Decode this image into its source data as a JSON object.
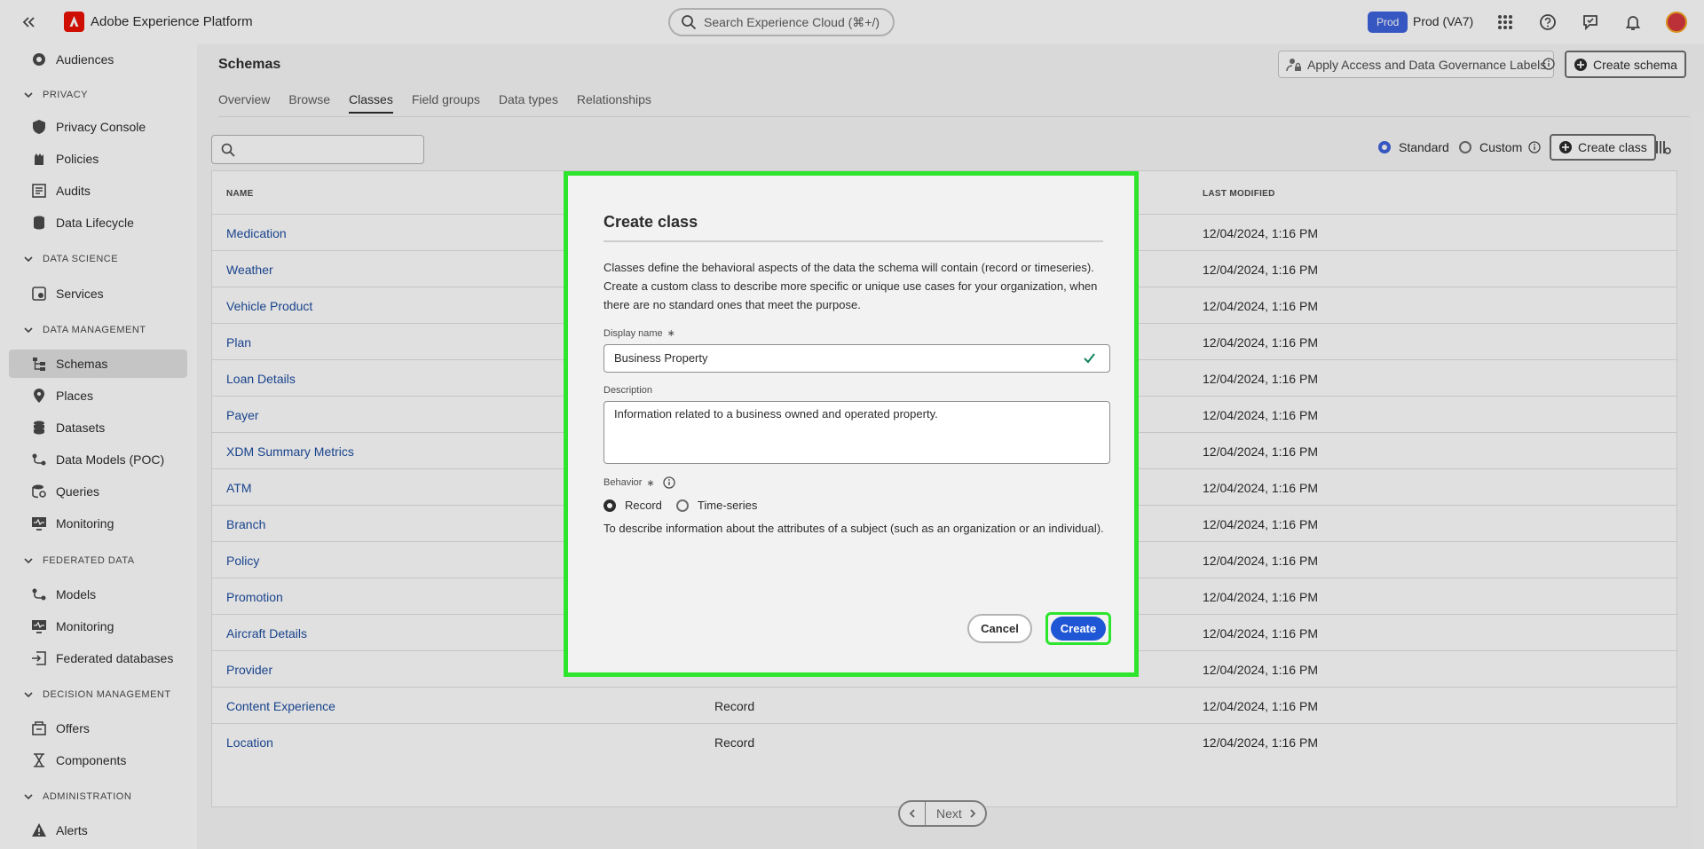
{
  "header": {
    "app_name": "Adobe Experience Platform",
    "search_placeholder": "Search Experience Cloud (⌘+/)",
    "env_badge": "Prod",
    "env_name": "Prod (VA7)"
  },
  "sidebar": {
    "items": [
      {
        "type": "item",
        "label": "Audiences",
        "icon": "audiences-icon"
      },
      {
        "type": "section",
        "label": "PRIVACY"
      },
      {
        "type": "item",
        "label": "Privacy Console",
        "icon": "privacy-console-icon"
      },
      {
        "type": "item",
        "label": "Policies",
        "icon": "policies-icon"
      },
      {
        "type": "item",
        "label": "Audits",
        "icon": "audits-icon"
      },
      {
        "type": "item",
        "label": "Data Lifecycle",
        "icon": "data-lifecycle-icon"
      },
      {
        "type": "section",
        "label": "DATA SCIENCE"
      },
      {
        "type": "item",
        "label": "Services",
        "icon": "services-icon"
      },
      {
        "type": "section",
        "label": "DATA MANAGEMENT"
      },
      {
        "type": "item",
        "label": "Schemas",
        "icon": "schemas-icon",
        "active": true
      },
      {
        "type": "item",
        "label": "Places",
        "icon": "places-icon"
      },
      {
        "type": "item",
        "label": "Datasets",
        "icon": "datasets-icon"
      },
      {
        "type": "item",
        "label": "Data Models (POC)",
        "icon": "data-models-icon"
      },
      {
        "type": "item",
        "label": "Queries",
        "icon": "queries-icon"
      },
      {
        "type": "item",
        "label": "Monitoring",
        "icon": "monitoring-icon"
      },
      {
        "type": "section",
        "label": "FEDERATED DATA"
      },
      {
        "type": "item",
        "label": "Models",
        "icon": "models-icon"
      },
      {
        "type": "item",
        "label": "Monitoring",
        "icon": "monitoring-icon"
      },
      {
        "type": "item",
        "label": "Federated databases",
        "icon": "federated-databases-icon"
      },
      {
        "type": "section",
        "label": "DECISION MANAGEMENT"
      },
      {
        "type": "item",
        "label": "Offers",
        "icon": "offers-icon"
      },
      {
        "type": "item",
        "label": "Components",
        "icon": "components-icon"
      },
      {
        "type": "section",
        "label": "ADMINISTRATION"
      },
      {
        "type": "item",
        "label": "Alerts",
        "icon": "alerts-icon"
      }
    ]
  },
  "page": {
    "title": "Schemas",
    "tabs": [
      "Overview",
      "Browse",
      "Classes",
      "Field groups",
      "Data types",
      "Relationships"
    ],
    "active_tab": "Classes",
    "apply_labels_button": "Apply Access and Data Governance Labels",
    "create_schema_button": "Create schema",
    "filter_standard": "Standard",
    "filter_custom": "Custom",
    "create_class_button": "Create class"
  },
  "table": {
    "headers": [
      "NAME",
      "",
      "LAST MODIFIED"
    ],
    "rows": [
      {
        "name": "Medication",
        "behavior": "",
        "modified": "12/04/2024, 1:16 PM"
      },
      {
        "name": "Weather",
        "behavior": "",
        "modified": "12/04/2024, 1:16 PM"
      },
      {
        "name": "Vehicle Product",
        "behavior": "",
        "modified": "12/04/2024, 1:16 PM"
      },
      {
        "name": "Plan",
        "behavior": "",
        "modified": "12/04/2024, 1:16 PM"
      },
      {
        "name": "Loan Details",
        "behavior": "",
        "modified": "12/04/2024, 1:16 PM"
      },
      {
        "name": "Payer",
        "behavior": "",
        "modified": "12/04/2024, 1:16 PM"
      },
      {
        "name": "XDM Summary Metrics",
        "behavior": "",
        "modified": "12/04/2024, 1:16 PM"
      },
      {
        "name": "ATM",
        "behavior": "",
        "modified": "12/04/2024, 1:16 PM"
      },
      {
        "name": "Branch",
        "behavior": "",
        "modified": "12/04/2024, 1:16 PM"
      },
      {
        "name": "Policy",
        "behavior": "",
        "modified": "12/04/2024, 1:16 PM"
      },
      {
        "name": "Promotion",
        "behavior": "",
        "modified": "12/04/2024, 1:16 PM"
      },
      {
        "name": "Aircraft Details",
        "behavior": "",
        "modified": "12/04/2024, 1:16 PM"
      },
      {
        "name": "Provider",
        "behavior": "",
        "modified": "12/04/2024, 1:16 PM"
      },
      {
        "name": "Content Experience",
        "behavior": "Record",
        "modified": "12/04/2024, 1:16 PM"
      },
      {
        "name": "Location",
        "behavior": "Record",
        "modified": "12/04/2024, 1:16 PM"
      }
    ]
  },
  "pager": {
    "next_label": "Next"
  },
  "dialog": {
    "title": "Create class",
    "description": "Classes define the behavioral aspects of the data the schema will contain (record or timeseries). Create a custom class to describe more specific or unique use cases for your organization, when there are no standard ones that meet the purpose.",
    "display_name_label": "Display name",
    "display_name_value": "Business Property",
    "description_label": "Description",
    "description_value": "Information related to a business owned and operated property.",
    "behavior_label": "Behavior",
    "behavior_options": [
      "Record",
      "Time-series"
    ],
    "behavior_selected": "Record",
    "behavior_help": "To describe information about the attributes of a subject (such as an organization or an individual).",
    "cancel_label": "Cancel",
    "create_label": "Create",
    "highlight_color": "#2ee52e",
    "primary_color": "#1f56d5"
  }
}
